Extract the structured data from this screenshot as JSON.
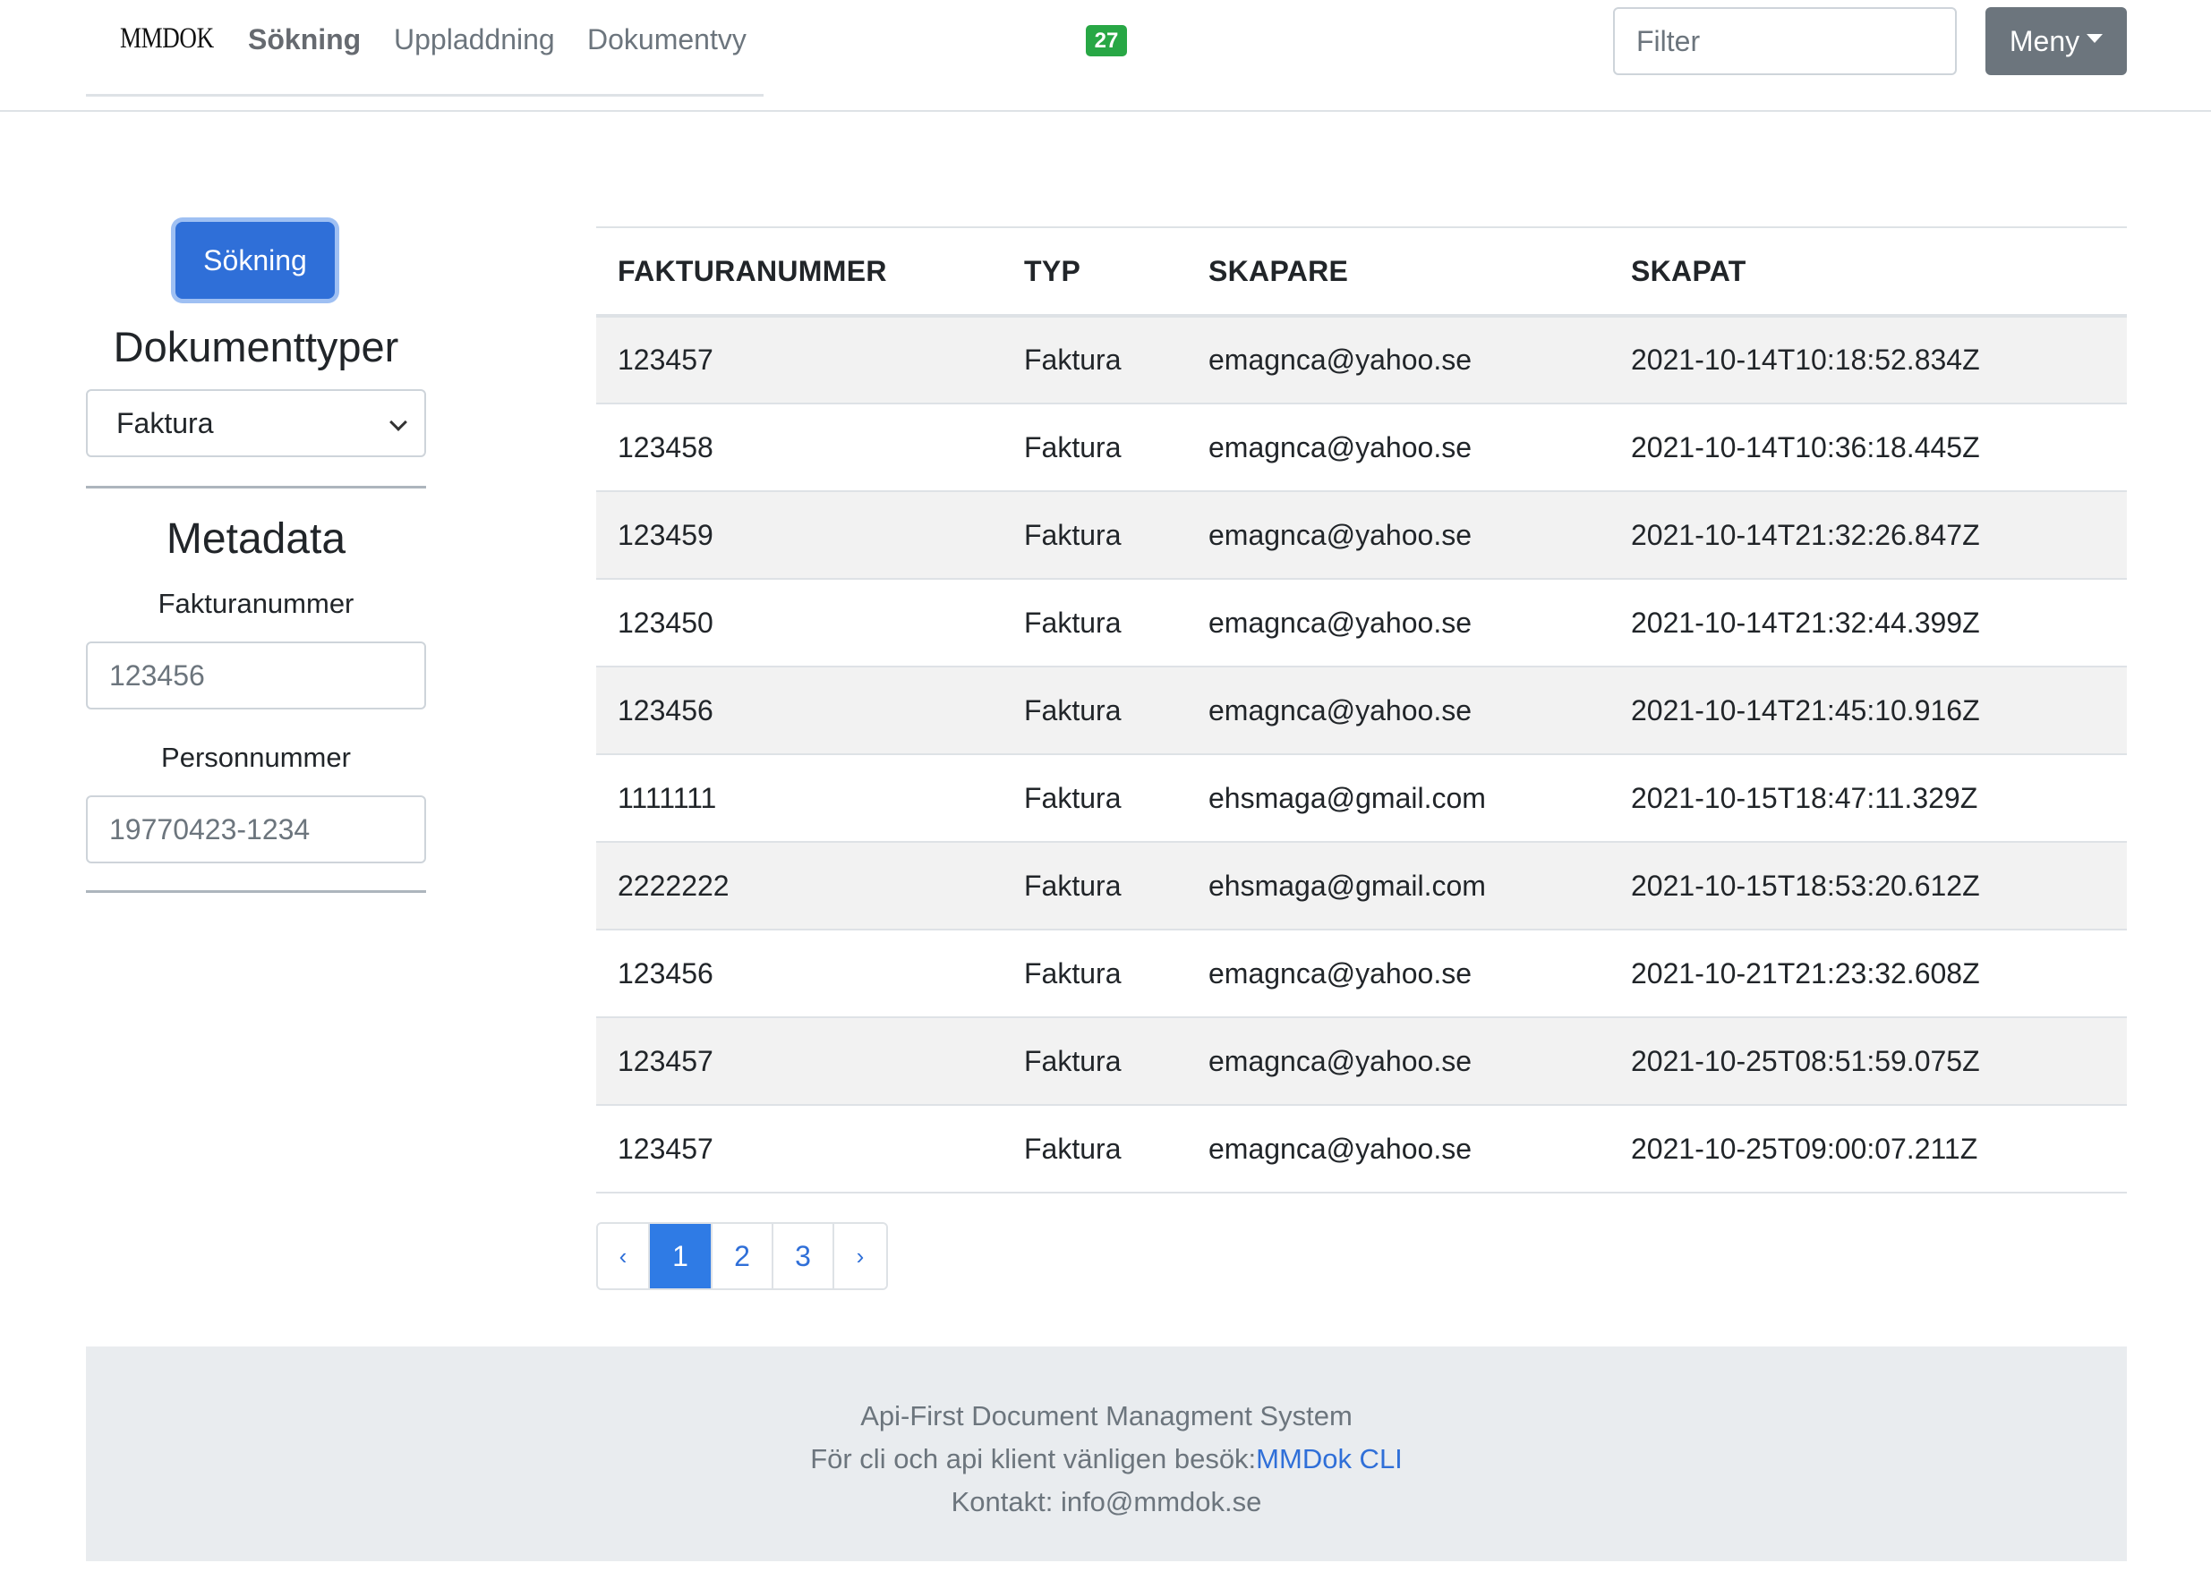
{
  "navbar": {
    "brand": "MMDOK",
    "links": [
      {
        "label": "Sökning",
        "active": true
      },
      {
        "label": "Uppladdning",
        "active": false
      },
      {
        "label": "Dokumentvy",
        "active": false
      }
    ],
    "badge_count": "27",
    "filter_placeholder": "Filter",
    "menu_label": "Meny"
  },
  "sidebar": {
    "search_button": "Sökning",
    "doctypes_title": "Dokumenttyper",
    "doctype_selected": "Faktura",
    "metadata_title": "Metadata",
    "fields": [
      {
        "label": "Fakturanummer",
        "placeholder": "123456"
      },
      {
        "label": "Personnummer",
        "placeholder": "19770423-1234"
      }
    ]
  },
  "table": {
    "headers": [
      "FAKTURANUMMER",
      "TYP",
      "SKAPARE",
      "SKAPAT"
    ],
    "rows": [
      [
        "123457",
        "Faktura",
        "emagnca@yahoo.se",
        "2021-10-14T10:18:52.834Z"
      ],
      [
        "123458",
        "Faktura",
        "emagnca@yahoo.se",
        "2021-10-14T10:36:18.445Z"
      ],
      [
        "123459",
        "Faktura",
        "emagnca@yahoo.se",
        "2021-10-14T21:32:26.847Z"
      ],
      [
        "123450",
        "Faktura",
        "emagnca@yahoo.se",
        "2021-10-14T21:32:44.399Z"
      ],
      [
        "123456",
        "Faktura",
        "emagnca@yahoo.se",
        "2021-10-14T21:45:10.916Z"
      ],
      [
        "1111111",
        "Faktura",
        "ehsmaga@gmail.com",
        "2021-10-15T18:47:11.329Z"
      ],
      [
        "2222222",
        "Faktura",
        "ehsmaga@gmail.com",
        "2021-10-15T18:53:20.612Z"
      ],
      [
        "123456",
        "Faktura",
        "emagnca@yahoo.se",
        "2021-10-21T21:23:32.608Z"
      ],
      [
        "123457",
        "Faktura",
        "emagnca@yahoo.se",
        "2021-10-25T08:51:59.075Z"
      ],
      [
        "123457",
        "Faktura",
        "emagnca@yahoo.se",
        "2021-10-25T09:00:07.211Z"
      ]
    ]
  },
  "pagination": {
    "prev": "‹",
    "pages": [
      "1",
      "2",
      "3"
    ],
    "active_page": "1",
    "next": "›"
  },
  "footer": {
    "line1": "Api-First Document Managment System",
    "line2_prefix": "För cli och api klient vänligen besök:",
    "line2_link": "MMDok CLI",
    "line3": "Kontakt: info@mmdok.se"
  },
  "colors": {
    "primary": "#2f6fd8",
    "badge": "#28a745",
    "menu_button": "#6c757d",
    "footer_bg": "#e9ecef"
  }
}
